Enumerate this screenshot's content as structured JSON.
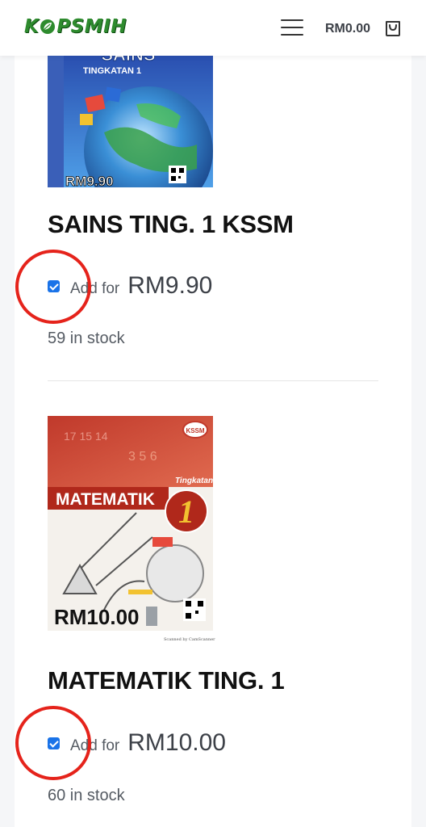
{
  "header": {
    "logo_text_left": "K",
    "logo_text_right": "PSMIH",
    "cart_total": "RM0.00",
    "icons": {
      "menu": "hamburger-menu-icon",
      "cart": "shopping-bag-icon"
    }
  },
  "products": [
    {
      "cover_subject": "SAINS",
      "cover_level": "TINGKATAN 1",
      "cover_price": "RM9.90",
      "title": "SAINS TING. 1 KSSM",
      "add_label": "Add for",
      "price": "RM9.90",
      "stock": "59 in stock",
      "checked": true
    },
    {
      "cover_badge": "KSSM",
      "cover_level": "Tingkatan",
      "cover_subject": "MATEMATIK",
      "cover_number": "1",
      "cover_price": "RM10.00",
      "cover_caption": "Scanned by CamScanner",
      "title": "MATEMATIK TING. 1",
      "add_label": "Add for",
      "price": "RM10.00",
      "stock": "60 in stock",
      "checked": true
    }
  ],
  "colors": {
    "accent": "#1a73e8",
    "highlight": "#e5231b",
    "brand": "#2e8b2e"
  }
}
